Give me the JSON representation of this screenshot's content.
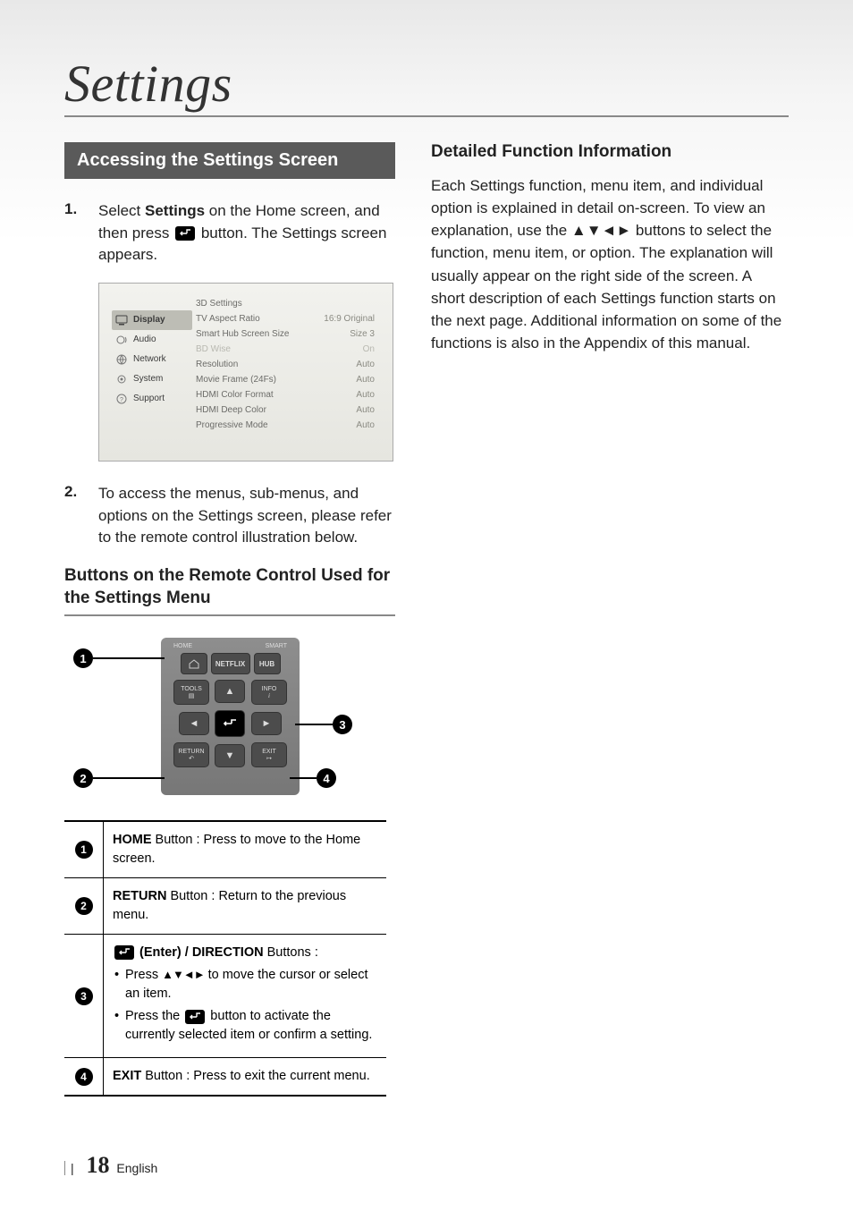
{
  "page_title": "Settings",
  "section_bar": "Accessing the Settings Screen",
  "step1_num": "1.",
  "step1_pre": "Select ",
  "step1_bold": "Settings",
  "step1_post": " on the Home screen, and then press ",
  "step1_post2": " button. The Settings screen appears.",
  "step2_num": "2.",
  "step2_text": "To access the menus, sub-menus, and options on the Settings screen, please refer to the remote control illustration below.",
  "sub_heading": "Buttons on the Remote Control Used for the Settings Menu",
  "sidebar": {
    "items": [
      {
        "label": "Display"
      },
      {
        "label": "Audio"
      },
      {
        "label": "Network"
      },
      {
        "label": "System"
      },
      {
        "label": "Support"
      }
    ]
  },
  "settings_rows": [
    {
      "label": "3D Settings",
      "value": ""
    },
    {
      "label": "TV Aspect Ratio",
      "value": "16:9 Original"
    },
    {
      "label": "Smart Hub Screen Size",
      "value": "Size 3"
    },
    {
      "label": "BD Wise",
      "value": "On",
      "dim": true
    },
    {
      "label": "Resolution",
      "value": "Auto"
    },
    {
      "label": "Movie Frame (24Fs)",
      "value": "Auto"
    },
    {
      "label": "HDMI Color Format",
      "value": "Auto"
    },
    {
      "label": "HDMI Deep Color",
      "value": "Auto"
    },
    {
      "label": "Progressive Mode",
      "value": "Auto"
    }
  ],
  "remote": {
    "top_left_label": "HOME",
    "top_right_label": "SMART",
    "netflix": "NETFLIX",
    "hub": "HUB",
    "tools": "TOOLS",
    "info": "INFO",
    "return": "RETURN",
    "exit": "EXIT"
  },
  "callouts": {
    "n1": "1",
    "n2": "2",
    "n3": "3",
    "n4": "4"
  },
  "table": {
    "r1_num": "1",
    "r1_b": "HOME",
    "r1_t": " Button : Press to move to the Home screen.",
    "r2_num": "2",
    "r2_b": "RETURN",
    "r2_t": " Button : Return to the previous menu.",
    "r3_num": "3",
    "r3_title_b": " (Enter) / DIRECTION",
    "r3_title_t": " Buttons :",
    "r3_li1_pre": "Press ",
    "r3_li1_post": " to move the cursor or select an item.",
    "r3_li2_pre": "Press the ",
    "r3_li2_post": " button to activate the currently selected item or confirm a setting.",
    "r4_num": "4",
    "r4_b": "EXIT",
    "r4_t": " Button : Press to exit the current menu."
  },
  "right_heading": "Detailed Function Information",
  "right_para": "Each Settings function, menu item, and individual option is explained in detail on-screen. To view an explanation, use the ▲▼◄► buttons to select the function, menu item, or option. The explanation will usually appear on the right side of the screen. A short description of each Settings function starts on the next page. Additional information on some of the functions is also in the Appendix of this manual.",
  "arrows_inline": "▲▼◄►",
  "footer_sep": "|",
  "footer_page": "18",
  "footer_lang": "English"
}
